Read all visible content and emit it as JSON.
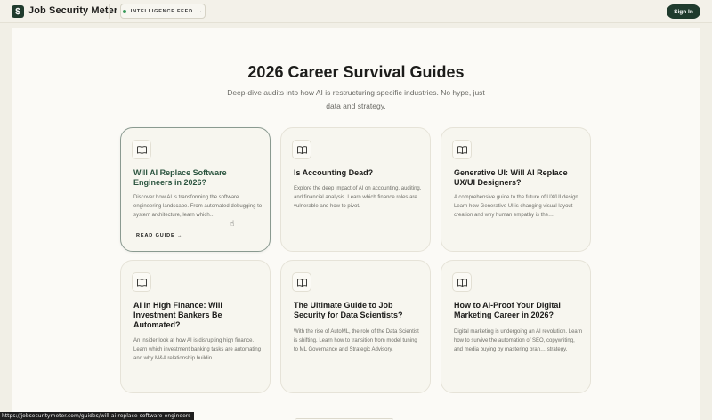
{
  "header": {
    "logo_glyph": "$",
    "brand": "Job Security Meter",
    "feed_label": "INTELLIGENCE FEED",
    "feed_arrow": "→",
    "signin_label": "Sign In",
    "accent_color": "#1f3b2d"
  },
  "hero": {
    "title": "2026 Career Survival Guides",
    "subtitle": "Deep-dive audits into how AI is restructuring specific industries. No hype, just data and strategy."
  },
  "cards": [
    {
      "title": "Will AI Replace Software Engineers in 2026?",
      "description": "Discover how AI is transforming the software engineering landscape. From automated debugging to system architecture, learn which…",
      "read_label": "READ GUIDE",
      "read_arrow": "→",
      "icon": "book-icon"
    },
    {
      "title": "Is Accounting Dead?",
      "description": "Explore the deep impact of AI on accounting, auditing, and financial analysis. Learn which finance roles are vulnerable and how to pivot.",
      "icon": "book-icon"
    },
    {
      "title": "Generative UI: Will AI Replace UX/UI Designers?",
      "description": "A comprehensive guide to the future of UX/UI design. Learn how Generative UI is changing visual layout creation and why human empathy is the…",
      "icon": "book-icon"
    },
    {
      "title": "AI in High Finance: Will Investment Bankers Be Automated?",
      "description": "An insider look at how AI is disrupting high finance. Learn which investment banking tasks are automating and why M&A relationship buildin…",
      "icon": "book-icon"
    },
    {
      "title": "The Ultimate Guide to Job Security for Data Scientists?",
      "description": "With the rise of AutoML, the role of the Data Scientist is shifting. Learn how to transition from model tuning to ML Governance and Strategic Advisory.",
      "icon": "book-icon"
    },
    {
      "title": "How to AI-Proof Your Digital Marketing Career in 2026?",
      "description": "Digital marketing is undergoing an AI revolution. Learn how to survive the automation of SEO, copywriting, and media buying by mastering bran… strategy.",
      "icon": "book-icon"
    }
  ],
  "status_url": "https://jobsecuritymeter.com/guides/will-ai-replace-software-engineers"
}
